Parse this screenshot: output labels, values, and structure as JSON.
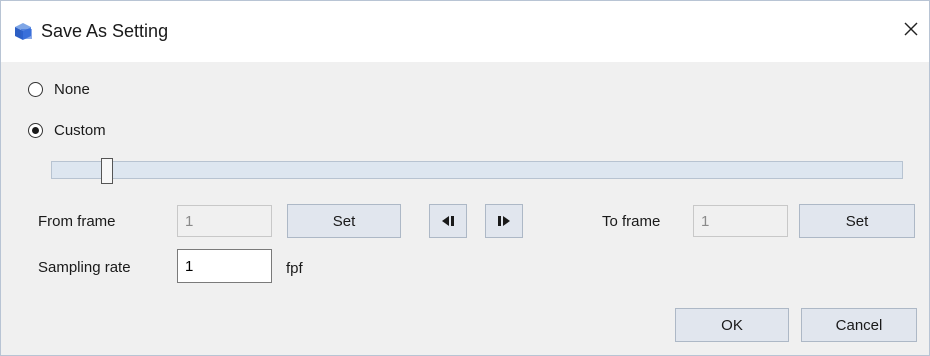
{
  "window": {
    "title": "Save As Setting",
    "close_glyph": "✕"
  },
  "range_options": [
    {
      "label": "None",
      "checked": false
    },
    {
      "label": "Custom",
      "checked": true
    }
  ],
  "slider": {
    "value_fraction": 0.06
  },
  "from_frame": {
    "label": "From frame",
    "value": "1",
    "set_label": "Set"
  },
  "to_frame": {
    "label": "To frame",
    "value": "1",
    "set_label": "Set"
  },
  "navigation": {
    "prev_icon": "step-back-icon",
    "next_icon": "step-forward-icon"
  },
  "sampling": {
    "label": "Sampling rate",
    "value": "1",
    "unit": "fpf"
  },
  "footer": {
    "ok_label": "OK",
    "cancel_label": "Cancel"
  }
}
